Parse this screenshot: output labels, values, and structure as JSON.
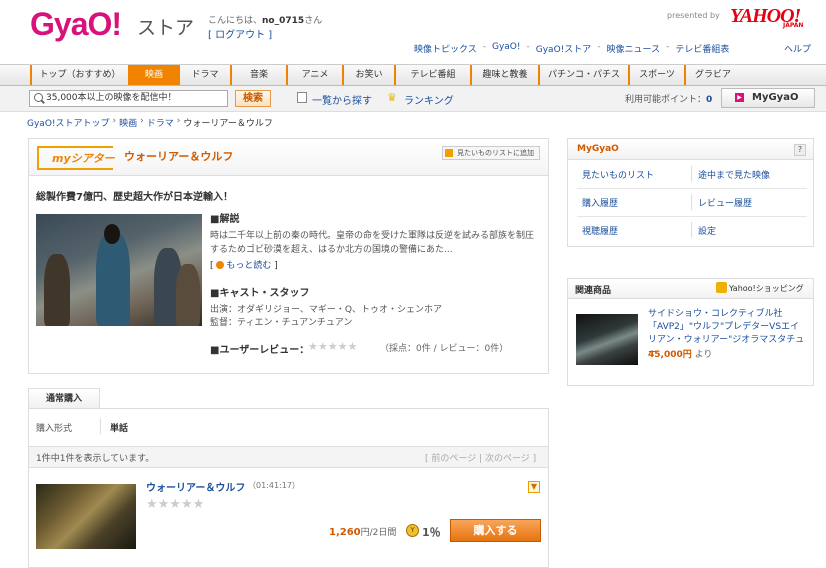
{
  "header": {
    "logo": "GyaO!",
    "store": "ストア",
    "greeting_prefix": "こんにちは、",
    "username": "no_0715",
    "greeting_suffix": "さん",
    "logout": "[ ログアウト ]",
    "presented_by": "presented by",
    "yahoo": "YAHOO!",
    "yahoo_japan": "JAPAN",
    "links": [
      "映像トピックス",
      "GyaO!",
      "GyaO!ストア",
      "映像ニュース",
      "テレビ番組表"
    ],
    "help": "ヘルプ"
  },
  "nav": {
    "items": [
      "トップ（おすすめ）",
      "映画",
      "ドラマ",
      "音楽",
      "アニメ",
      "お笑い",
      "テレビ番組",
      "趣味と教養",
      "パチンコ・パチスロ",
      "スポーツ",
      "グラビア"
    ],
    "active_index": 1
  },
  "search": {
    "placeholder": "35,000本以上の映像を配信中！",
    "button": "検索",
    "list_link": "一覧から探す",
    "ranking_link": "ランキング",
    "points_label": "利用可能ポイント：",
    "points_value": "0",
    "mygyao_button": "MyGyaO"
  },
  "breadcrumb": [
    "GyaO!ストアトップ",
    "映画",
    "ドラマ",
    "ウォーリアー＆ウルフ"
  ],
  "movie": {
    "theater_label": "myシアター",
    "title": "ウォーリアー＆ウルフ",
    "wishlist_button": "見たいものリストに追加",
    "tagline": "総製作費7億円、歴史超大作が日本逆輸入！",
    "desc_head": "■解説",
    "desc_text": "時は二千年以上前の秦の時代。皇帝の命を受けた軍隊は反逆を試みる部族を制圧するためゴビ砂漠を超え、はるか北方の国境の警備にあた...",
    "more": "もっと読む",
    "cast_head": "■キャスト・スタッフ",
    "cast_line1": "出演：オダギリジョー、マギー・Q、トゥオ・シェンホア",
    "cast_line2": "監督：ティエン・チュアンチュアン",
    "review_head": "■ユーザーレビュー：",
    "review_stars": "★★★★★",
    "review_counts": "（採点：0件 / レビュー：0件）"
  },
  "purchase": {
    "tab": "通常購入",
    "form_label": "購入形式",
    "form_value": "単話",
    "count_text": "1件中1件を表示しています。",
    "pager": "[ 前のページ | 次のページ ]",
    "item_title": "ウォーリアー＆ウルフ",
    "item_duration": "（01:41:17）",
    "item_stars": "★★★★★",
    "price_value": "1,260",
    "price_unit": "円/2日間",
    "points_rate": "1％",
    "buy_button": "購入する"
  },
  "mygyao": {
    "title": "MyGyaO",
    "help": "?",
    "links": [
      "見たいものリスト",
      "途中まで見た映像",
      "購入履歴",
      "レビュー履歴",
      "視聴履歴",
      "設定"
    ]
  },
  "related": {
    "title": "関連商品",
    "shop_label": "Yahoo!ショッピング",
    "item_name": "サイドショウ・コレクティブル社「AVP2」\"ウルフ\"プレデターVSエイリアン・ウォリアー\"ジオラマスタチュー",
    "price_value": "45,000円",
    "price_suffix": " より"
  }
}
